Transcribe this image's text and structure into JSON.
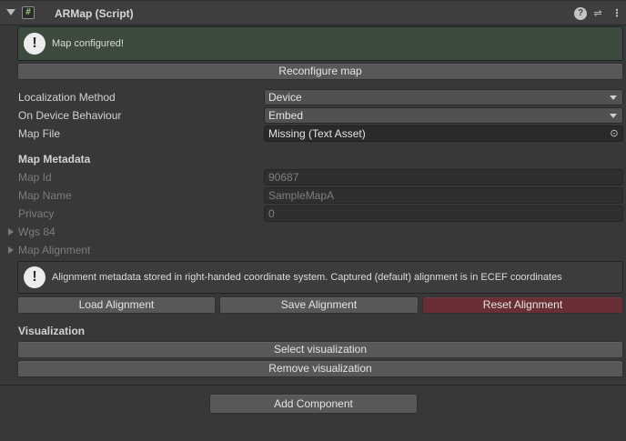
{
  "component": {
    "title": "ARMap (Script)",
    "script_glyph": "#",
    "help_glyph": "?",
    "settings_glyph": "⇌",
    "menu_glyph": "⋮"
  },
  "status": {
    "message": "Map configured!",
    "badge": "!"
  },
  "reconfigure_label": "Reconfigure map",
  "properties": {
    "localization_method": {
      "label": "Localization Method",
      "value": "Device"
    },
    "on_device_behaviour": {
      "label": "On Device Behaviour",
      "value": "Embed"
    },
    "map_file": {
      "label": "Map File",
      "value": "Missing (Text Asset)",
      "picker_glyph": "⊙"
    }
  },
  "metadata": {
    "title": "Map Metadata",
    "map_id": {
      "label": "Map Id",
      "value": "90687"
    },
    "map_name": {
      "label": "Map Name",
      "value": "SampleMapA"
    },
    "privacy": {
      "label": "Privacy",
      "value": "0"
    },
    "wgs84": {
      "label": "Wgs 84"
    },
    "map_alignment": {
      "label": "Map Alignment"
    }
  },
  "alignment_info": {
    "badge": "!",
    "message": "Alignment metadata stored in right-handed coordinate system. Captured (default) alignment is in ECEF coordinates"
  },
  "alignment_buttons": {
    "load": "Load Alignment",
    "save": "Save Alignment",
    "reset": "Reset Alignment"
  },
  "visualization": {
    "title": "Visualization",
    "select_label": "Select visualization",
    "remove_label": "Remove visualization"
  },
  "add_component_label": "Add Component",
  "colors": {
    "background": "#383838",
    "success_box": "#3d4a3e",
    "danger_button": "#6a2f35",
    "button": "#585858"
  }
}
